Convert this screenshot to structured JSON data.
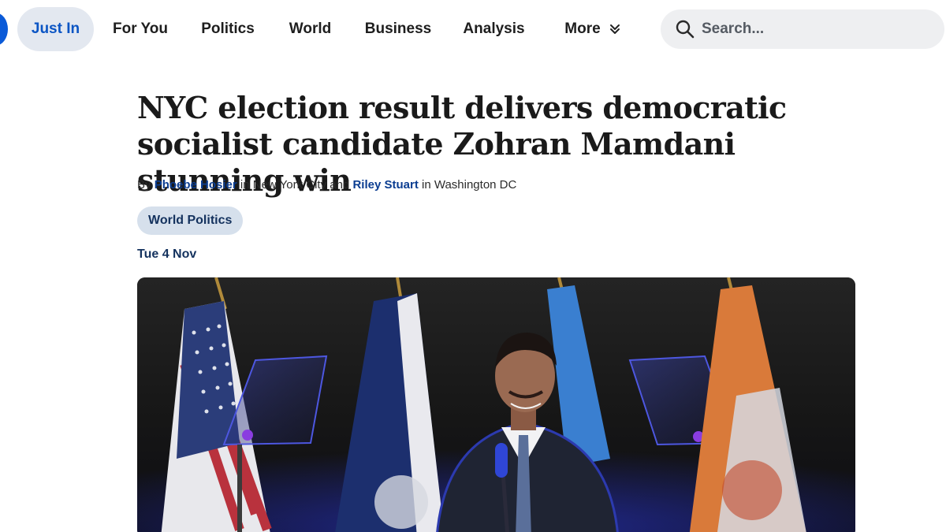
{
  "nav": {
    "items": [
      {
        "label": "Just In",
        "active": true
      },
      {
        "label": "For You"
      },
      {
        "label": "Politics"
      },
      {
        "label": "World"
      },
      {
        "label": "Business"
      },
      {
        "label": "Analysis"
      },
      {
        "label": "More",
        "icon": "double-chevron-down-icon"
      }
    ],
    "search": {
      "placeholder": "Search..."
    }
  },
  "article": {
    "headline": "NYC election result delivers democratic socialist candidate Zohran Mamdani stunning win",
    "byline": {
      "prefix": "By",
      "author1": "Phoebe Hosier",
      "loc1": "in New York City and",
      "author2": "Riley Stuart",
      "loc2": "in Washington DC"
    },
    "tag": "World Politics",
    "date": "Tue 4 Nov"
  },
  "colors": {
    "accent": "#0b55c4",
    "tag_bg": "#d6e0ec",
    "link": "#0b3d91"
  }
}
